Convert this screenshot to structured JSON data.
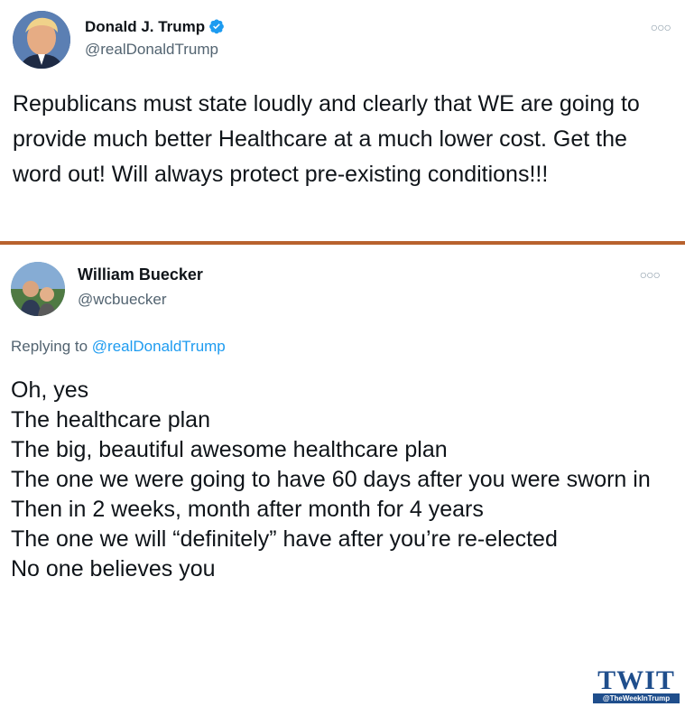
{
  "original_tweet": {
    "display_name": "Donald J. Trump",
    "handle": "@realDonaldTrump",
    "verified": true,
    "more_icon": "more-options-icon",
    "text": "Republicans must state loudly and clearly that WE are going to provide much better Healthcare at a much lower cost. Get the word out! Will always protect pre-existing conditions!!!"
  },
  "divider_color": "#b8622d",
  "reply_tweet": {
    "display_name": "William Buecker",
    "handle": "@wcbuecker",
    "replying_prefix": "Replying to",
    "replying_handle": "@realDonaldTrump",
    "lines": [
      "Oh, yes",
      "The healthcare plan",
      "The big, beautiful awesome healthcare plan",
      "The one we were going to have 60 days after you were sworn in",
      "Then in 2 weeks, month after month for 4 years",
      "The one we will “definitely” have after you’re re-elected",
      "No one believes you"
    ]
  },
  "watermark": {
    "title": "TWIT",
    "subtitle": "@TheWeekInTrump"
  },
  "colors": {
    "link": "#1d9bf0",
    "verified": "#1d9bf0",
    "secondary_text": "#536471"
  }
}
